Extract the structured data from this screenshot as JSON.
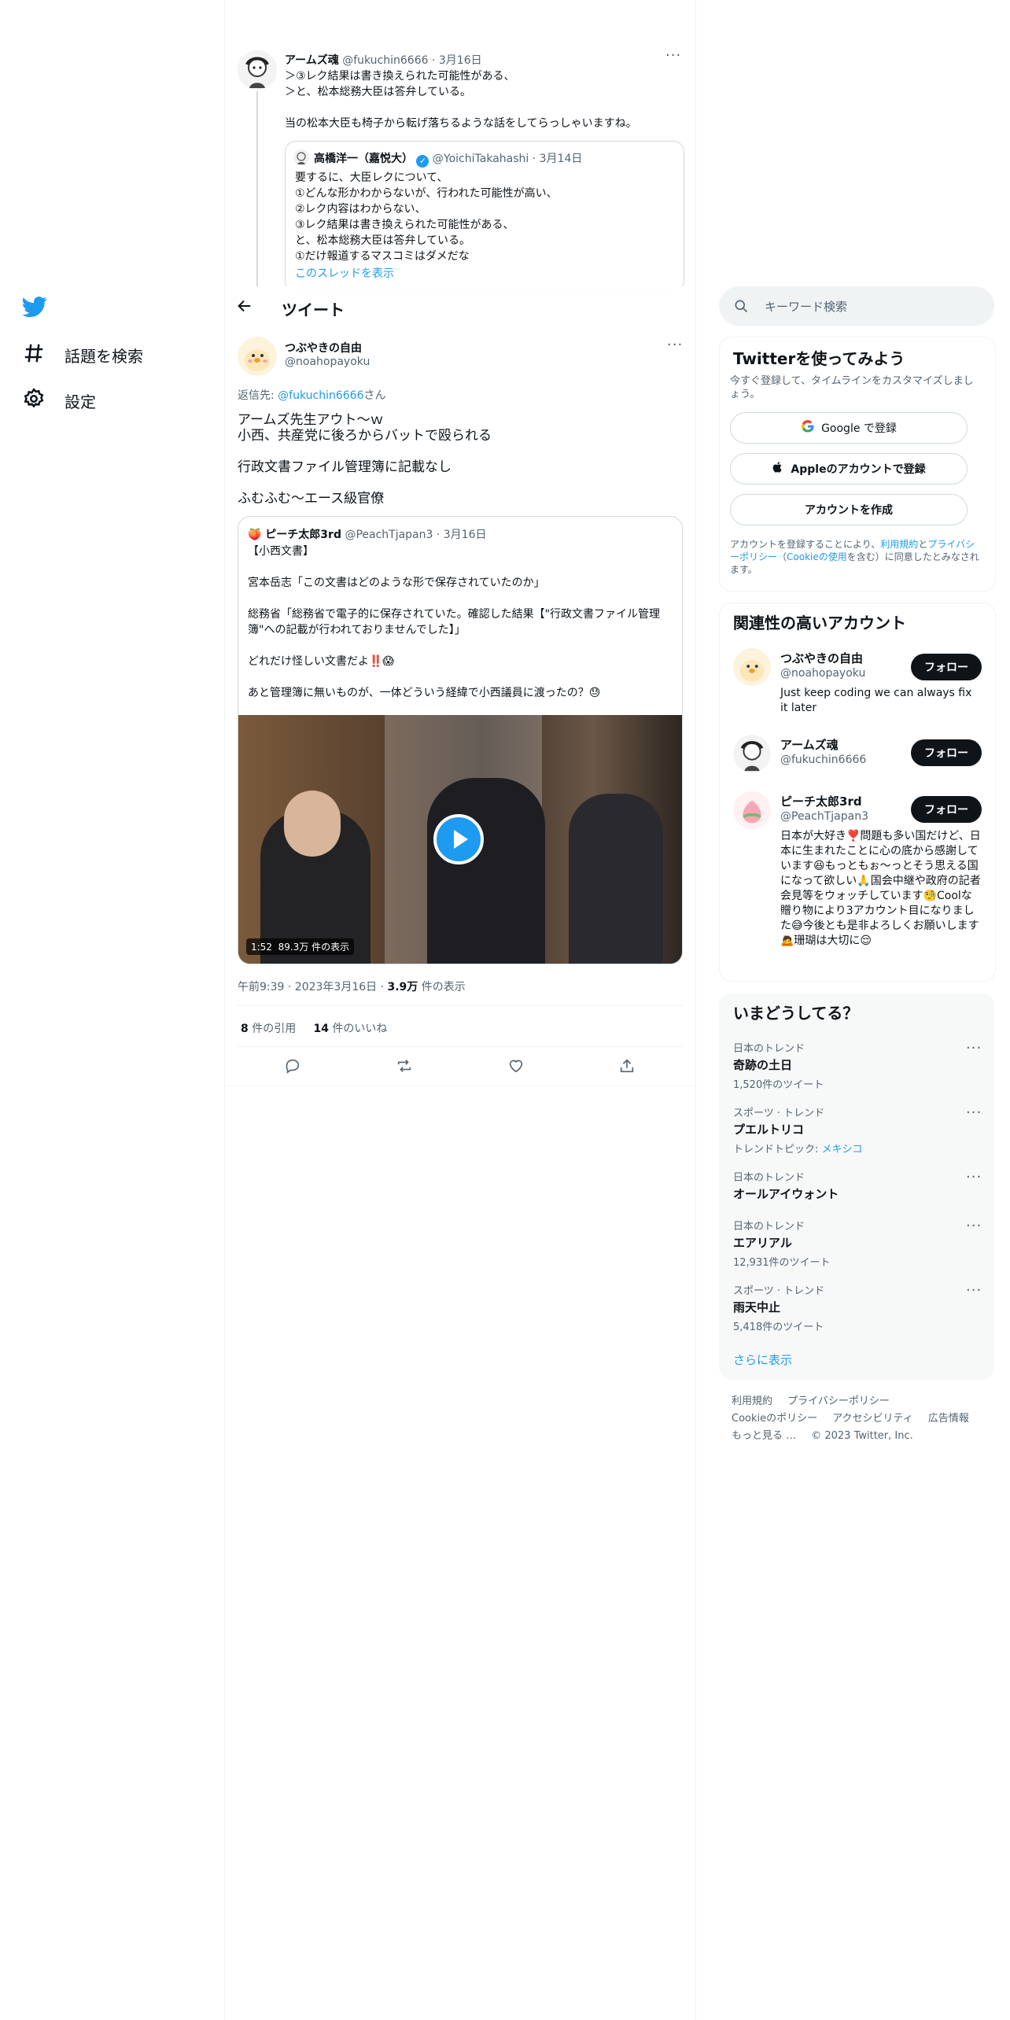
{
  "nav": {
    "items": [
      {
        "icon": "hashtag-icon",
        "label": "話題を検索"
      },
      {
        "icon": "gear-icon",
        "label": "設定"
      }
    ]
  },
  "parent_tweet": {
    "name": "アームズ魂",
    "handle": "@fukuchin6666",
    "date": "· 3月16日",
    "text": "＞③レク結果は書き換えられた可能性がある、\n＞と、松本総務大臣は答弁している。\n\n当の松本大臣も椅子から転げ落ちるような話をしてらっしゃいますね。",
    "quote": {
      "name": "高橋洋一（嘉悦大）",
      "handle": "@YoichiTakahashi",
      "date": "· 3月14日",
      "text": "要するに、大臣レクについて、\n①どんな形かわからないが、行われた可能性が高い、\n②レク内容はわからない、\n③レク結果は書き換えられた可能性がある、\nと、松本総務大臣は答弁している。\n①だけ報道するマスコミはダメだな",
      "show_thread": "このスレッドを表示"
    }
  },
  "header": {
    "title": "ツイート"
  },
  "main_tweet": {
    "name": "つぶやきの自由",
    "handle": "@noahopayoku",
    "reply_prefix": "返信先: ",
    "reply_to": "@fukuchin6666",
    "reply_suffix": "さん",
    "text": "アームズ先生アウト～ｗ\n小西、共産党に後ろからバットで殴られる\n\n行政文書ファイル管理簿に記載なし\n\nふむふむ～エース級官僚",
    "quote": {
      "name": "🍑 ピーチ太郎3rd",
      "handle": "@PeachTjapan3",
      "date": "· 3月16日",
      "text": "【小西文書】\n\n宮本岳志「この文書はどのような形で保存されていたのか」\n\n総務省「総務省で電子的に保存されていた。確認した結果【\"行政文書ファイル管理簿\"への記載が行われておりませんでした】」\n\nどれだけ怪しい文書だよ‼️😱\n\nあと管理簿に無いものが、一体どういう経緯で小西議員に渡ったの？😓",
      "video_duration": "1:52",
      "video_views": "89.3万 件の表示"
    },
    "timestamp": "午前9:39 · 2023年3月16日 · ",
    "views_count": "3.9万",
    "views_label": " 件の表示",
    "quotes_count": "8",
    "quotes_label": " 件の引用",
    "likes_count": "14",
    "likes_label": " 件のいいね"
  },
  "search": {
    "placeholder": "キーワード検索"
  },
  "signup": {
    "title": "Twitterを使ってみよう",
    "subtitle": "今すぐ登録して、タイムラインをカスタマイズしましょう。",
    "google_label": "Google で登録",
    "apple_label": "Appleのアカウントで登録",
    "create_label": "アカウントを作成",
    "legal_1": "アカウントを登録することにより、",
    "legal_terms": "利用規約",
    "legal_2": "と",
    "legal_privacy": "プライバシーポリシー",
    "legal_3": "（",
    "legal_cookie": "Cookieの使用",
    "legal_4": "を含む）に同意したとみなされます。"
  },
  "relevant": {
    "title": "関連性の高いアカウント",
    "follow_label": "フォロー",
    "accounts": [
      {
        "name": "つぶやきの自由",
        "handle": "@noahopayoku",
        "bio": "Just keep coding we can always fix it later"
      },
      {
        "name": "アームズ魂",
        "handle": "@fukuchin6666",
        "bio": ""
      },
      {
        "name": "ピーチ太郎3rd",
        "handle": "@PeachTjapan3",
        "bio": "日本が大好き❣️問題も多い国だけど、日本に生まれたことに心の底から感謝しています😆もっともぉ～っとそう思える国になって欲しい🙏国会中継や政府の記者会見等をウォッチしています🧐Coolな贈り物により3アカウント目になりました😅今後とも是非よろしくお願いします🙇珊瑚は大切に😌"
      }
    ]
  },
  "trends": {
    "title": "いまどうしてる？",
    "items": [
      {
        "meta": "日本のトレンド",
        "name": "奇跡の土日",
        "count": "1,520件のツイート"
      },
      {
        "meta": "スポーツ · トレンド",
        "name": "プエルトリコ",
        "count": "トレンドトピック: ",
        "topic": "メキシコ"
      },
      {
        "meta": "日本のトレンド",
        "name": "オールアイウォント",
        "count": ""
      },
      {
        "meta": "日本のトレンド",
        "name": "エアリアル",
        "count": "12,931件のツイート"
      },
      {
        "meta": "スポーツ · トレンド",
        "name": "雨天中止",
        "count": "5,418件のツイート"
      }
    ],
    "show_more": "さらに表示"
  },
  "footer": {
    "terms": "利用規約",
    "privacy": "プライバシーポリシー",
    "cookie": "Cookieのポリシー",
    "accessibility": "アクセシビリティ",
    "ads": "広告情報",
    "more": "もっと見る …",
    "copyright": "© 2023 Twitter, Inc."
  },
  "colors": {
    "accent": "#1d9bf0",
    "text": "#0f1419",
    "muted": "#536471",
    "border": "#eff3f4",
    "panel_bg": "#f7f9f9"
  }
}
